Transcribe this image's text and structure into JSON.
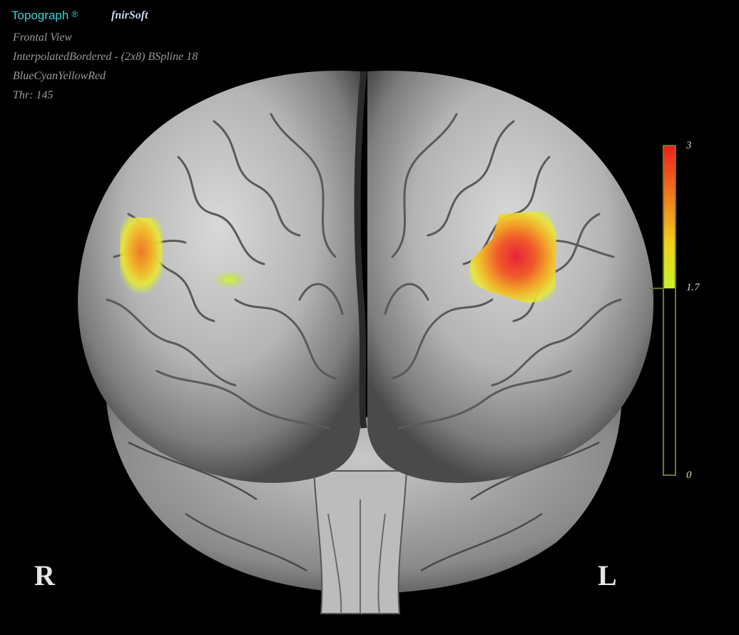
{
  "header": {
    "app_name": "Topograph",
    "registered_mark": "®",
    "vendor": "fnirSoft"
  },
  "info_lines": [
    "Frontal View",
    "InterpolatedBordered - (2x8) BSpline 18",
    "BlueCyanYellowRed",
    "Thr: 145"
  ],
  "view": {
    "right_label": "R",
    "left_label": "L"
  },
  "colorbar": {
    "max_label": "3",
    "threshold_label": "1.7",
    "min_label": "0",
    "max": 3,
    "threshold": 1.7,
    "min": 0,
    "colors": [
      "#f01e1e",
      "#f07a1e",
      "#f0d21e",
      "#c8f028"
    ],
    "frame_color": "#6a7a2a"
  },
  "activations": [
    {
      "name": "right-lateral-prefrontal",
      "level": 2.3
    },
    {
      "name": "right-medial-frontal",
      "level": 1.8
    },
    {
      "name": "left-lateral-prefrontal",
      "level": 2.9
    }
  ]
}
